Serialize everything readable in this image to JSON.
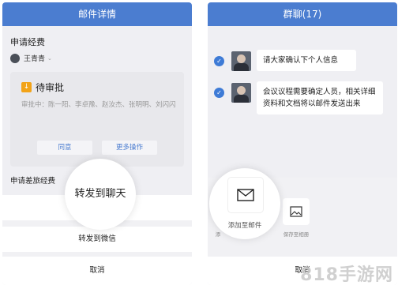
{
  "left": {
    "title": "邮件详情",
    "subject": "申请经费",
    "sender": "王青青",
    "card": {
      "title": "待审批",
      "approvers": "审批中：陈一阳、李卓豫、赵汝杰、张明明、刘闪闪",
      "approve": "同意",
      "more": "更多操作"
    },
    "subject2": "申请差旅经费",
    "forward_chat": "转发到聊天",
    "forward_wechat": "转发到微信",
    "cancel": "取消"
  },
  "right": {
    "title": "群聊(17)",
    "messages": [
      "请大家确认下个人信息",
      "会议议程需要确定人员，相关详细资料和文档将以邮件发送出来"
    ],
    "add_to_mail": "添加至邮件",
    "save_album": "保存至相册",
    "partial_label": "添",
    "cancel": "取消"
  },
  "watermark": "818手游网",
  "colors": {
    "header": "#4b7dd0",
    "check": "#3e7bd6",
    "badge": "#f2a318"
  }
}
